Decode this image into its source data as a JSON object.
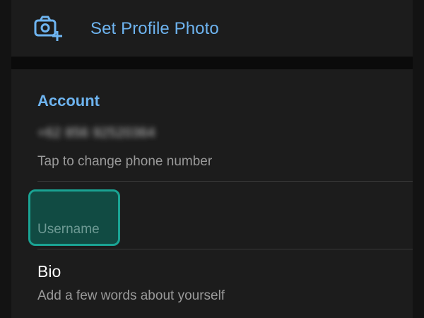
{
  "header": {
    "set_photo_label": "Set Profile Photo",
    "camera_icon": "camera-add-icon"
  },
  "account": {
    "section_title": "Account",
    "phone_value": "+62 856 92520364",
    "phone_hint": "Tap to change phone number",
    "username_placeholder": "Username",
    "bio_label": "Bio",
    "bio_hint": "Add a few words about yourself"
  },
  "colors": {
    "accent_blue": "#6eb4f0",
    "focus_teal": "#1aa393",
    "background": "#1c1c1c"
  }
}
